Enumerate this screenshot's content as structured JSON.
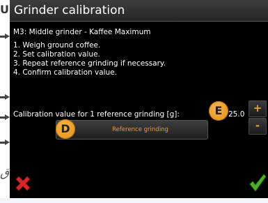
{
  "dialog": {
    "title": "Grinder calibration",
    "subtitle": "M3: Middle grinder  - Kaffee Maximum",
    "steps": [
      "1. Weigh ground coffee.",
      "2. Set calibration value.",
      "3. Repeat reference grinding if necessary.",
      "4. Confirm calibration value."
    ],
    "calibration_label": "Calibration value for 1 reference grinding [g]:",
    "calibration_value": "25.0",
    "plus_label": "+",
    "minus_label": "-",
    "reference_button_label": "Reference grinding",
    "badge_e": "E",
    "badge_d": "D"
  },
  "background": {
    "fragment_top": "Ul",
    "fragment_bottom": "ق"
  },
  "icons": {
    "cancel": "cancel-x-icon",
    "confirm": "checkmark-icon"
  },
  "colors": {
    "screen_bg": "#000000",
    "accent_orange": "#f29d2c",
    "badge_orange": "#f0a43a",
    "cancel_red": "#d7262b",
    "confirm_green": "#4caf26"
  }
}
